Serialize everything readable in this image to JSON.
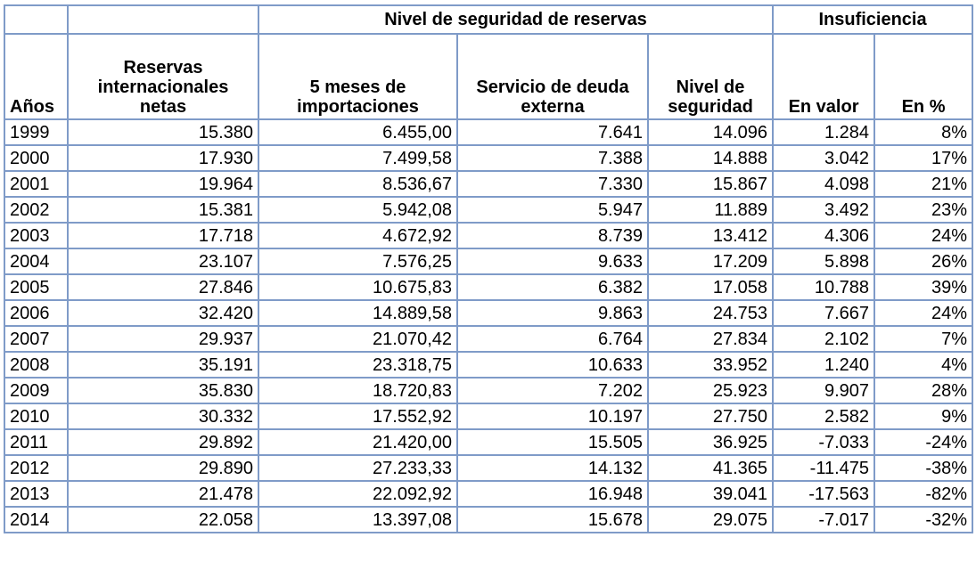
{
  "table": {
    "group_headers": {
      "security": "Nivel de seguridad de reservas",
      "shortfall": "Insuficiencia"
    },
    "columns": {
      "years": "Años",
      "net_reserves": "Reservas internacionales netas",
      "five_months_imports": "5 meses de importaciones",
      "external_debt_service": "Servicio de deuda externa",
      "security_level": "Nivel de seguridad",
      "value": "En valor",
      "percent": "En %"
    },
    "rows": [
      {
        "year": "1999",
        "net_reserves": "15.380",
        "five_months_imports": "6.455,00",
        "external_debt_service": "7.641",
        "security_level": "14.096",
        "value": "1.284",
        "percent": "8%"
      },
      {
        "year": "2000",
        "net_reserves": "17.930",
        "five_months_imports": "7.499,58",
        "external_debt_service": "7.388",
        "security_level": "14.888",
        "value": "3.042",
        "percent": "17%"
      },
      {
        "year": "2001",
        "net_reserves": "19.964",
        "five_months_imports": "8.536,67",
        "external_debt_service": "7.330",
        "security_level": "15.867",
        "value": "4.098",
        "percent": "21%"
      },
      {
        "year": "2002",
        "net_reserves": "15.381",
        "five_months_imports": "5.942,08",
        "external_debt_service": "5.947",
        "security_level": "11.889",
        "value": "3.492",
        "percent": "23%"
      },
      {
        "year": "2003",
        "net_reserves": "17.718",
        "five_months_imports": "4.672,92",
        "external_debt_service": "8.739",
        "security_level": "13.412",
        "value": "4.306",
        "percent": "24%"
      },
      {
        "year": "2004",
        "net_reserves": "23.107",
        "five_months_imports": "7.576,25",
        "external_debt_service": "9.633",
        "security_level": "17.209",
        "value": "5.898",
        "percent": "26%"
      },
      {
        "year": "2005",
        "net_reserves": "27.846",
        "five_months_imports": "10.675,83",
        "external_debt_service": "6.382",
        "security_level": "17.058",
        "value": "10.788",
        "percent": "39%"
      },
      {
        "year": "2006",
        "net_reserves": "32.420",
        "five_months_imports": "14.889,58",
        "external_debt_service": "9.863",
        "security_level": "24.753",
        "value": "7.667",
        "percent": "24%"
      },
      {
        "year": "2007",
        "net_reserves": "29.937",
        "five_months_imports": "21.070,42",
        "external_debt_service": "6.764",
        "security_level": "27.834",
        "value": "2.102",
        "percent": "7%"
      },
      {
        "year": "2008",
        "net_reserves": "35.191",
        "five_months_imports": "23.318,75",
        "external_debt_service": "10.633",
        "security_level": "33.952",
        "value": "1.240",
        "percent": "4%"
      },
      {
        "year": "2009",
        "net_reserves": "35.830",
        "five_months_imports": "18.720,83",
        "external_debt_service": "7.202",
        "security_level": "25.923",
        "value": "9.907",
        "percent": "28%"
      },
      {
        "year": "2010",
        "net_reserves": "30.332",
        "five_months_imports": "17.552,92",
        "external_debt_service": "10.197",
        "security_level": "27.750",
        "value": "2.582",
        "percent": "9%"
      },
      {
        "year": "2011",
        "net_reserves": "29.892",
        "five_months_imports": "21.420,00",
        "external_debt_service": "15.505",
        "security_level": "36.925",
        "value": "-7.033",
        "percent": "-24%"
      },
      {
        "year": "2012",
        "net_reserves": "29.890",
        "five_months_imports": "27.233,33",
        "external_debt_service": "14.132",
        "security_level": "41.365",
        "value": "-11.475",
        "percent": "-38%"
      },
      {
        "year": "2013",
        "net_reserves": "21.478",
        "five_months_imports": "22.092,92",
        "external_debt_service": "16.948",
        "security_level": "39.041",
        "value": "-17.563",
        "percent": "-82%"
      },
      {
        "year": "2014",
        "net_reserves": "22.058",
        "five_months_imports": "13.397,08",
        "external_debt_service": "15.678",
        "security_level": "29.075",
        "value": "-7.017",
        "percent": "-32%"
      }
    ],
    "border_color": "#7f9bc8"
  }
}
